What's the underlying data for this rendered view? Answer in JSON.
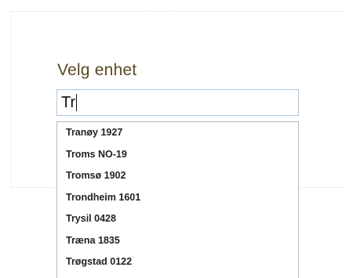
{
  "form": {
    "heading": "Velg enhet",
    "search_value": "Tr"
  },
  "autocomplete": {
    "options": [
      {
        "label": "Tranøy 1927"
      },
      {
        "label": "Troms NO-19"
      },
      {
        "label": "Tromsø 1902"
      },
      {
        "label": "Trondheim 1601"
      },
      {
        "label": "Trysil 0428"
      },
      {
        "label": "Træna 1835"
      },
      {
        "label": "Trøgstad 0122"
      }
    ]
  },
  "colors": {
    "heading": "#5a4a24",
    "input_border": "#a9c7e4"
  }
}
